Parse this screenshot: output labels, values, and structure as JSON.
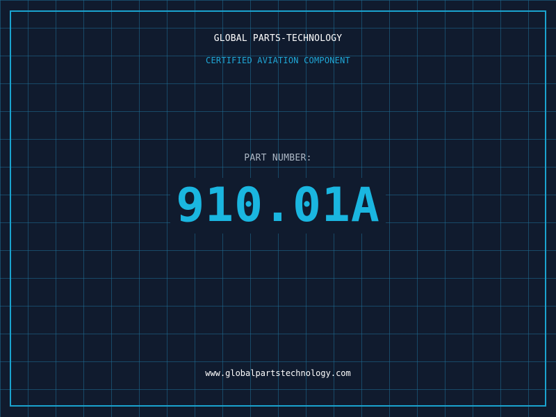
{
  "header": {
    "company": "GLOBAL PARTS-TECHNOLOGY",
    "subtitle": "CERTIFIED AVIATION COMPONENT"
  },
  "main": {
    "label": "PART NUMBER:",
    "part_number": "910.01A"
  },
  "footer": {
    "website": "www.globalpartstechnology.com"
  },
  "colors": {
    "background": "#101b2e",
    "grid": "#1f6f96",
    "accent": "#1ab6e0",
    "frame": "#1aa3cf"
  }
}
